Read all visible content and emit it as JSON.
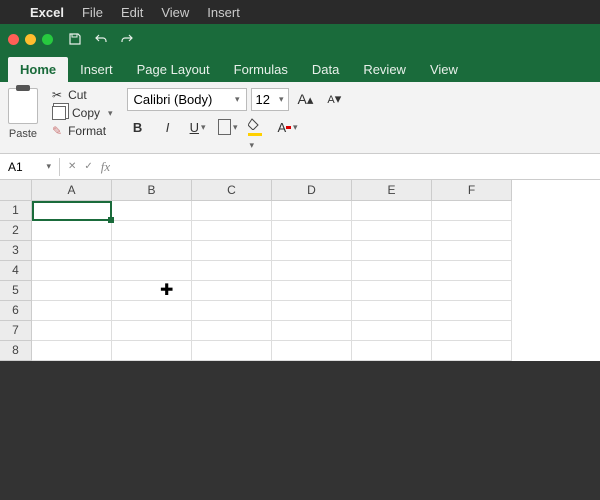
{
  "menubar": {
    "app_name": "Excel",
    "items": [
      "File",
      "Edit",
      "View",
      "Insert"
    ]
  },
  "tabs": {
    "items": [
      "Home",
      "Insert",
      "Page Layout",
      "Formulas",
      "Data",
      "Review",
      "View"
    ],
    "active_index": 0
  },
  "ribbon": {
    "paste": "Paste",
    "cut": "Cut",
    "copy": "Copy",
    "format": "Format",
    "font_name": "Calibri (Body)",
    "font_size": "12",
    "grow": "A",
    "shrink": "A",
    "bold": "B",
    "italic": "I",
    "underline": "U",
    "fontcolor": "A"
  },
  "formula": {
    "name_box": "A1",
    "fx": "fx",
    "value": ""
  },
  "sheet": {
    "columns": [
      "A",
      "B",
      "C",
      "D",
      "E",
      "F"
    ],
    "rows": [
      "1",
      "2",
      "3",
      "4",
      "5",
      "6",
      "7",
      "8"
    ],
    "selected": "A1"
  },
  "colors": {
    "brand": "#1a6b3b"
  }
}
